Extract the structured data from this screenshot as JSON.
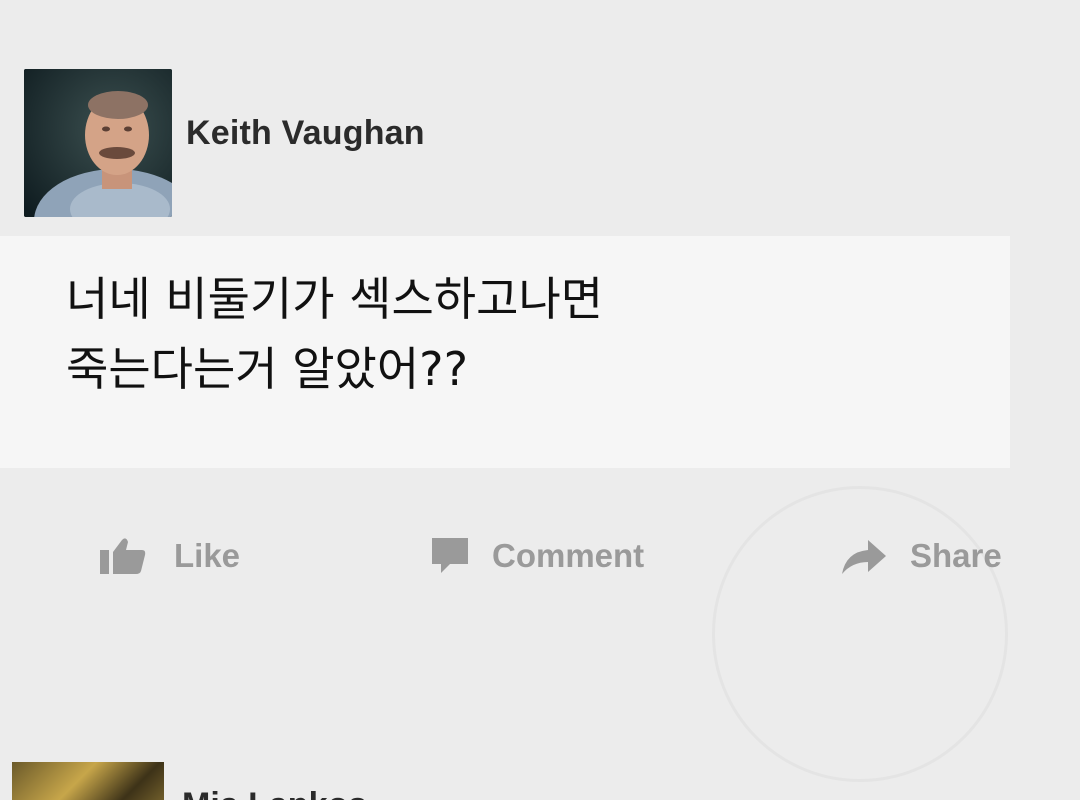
{
  "post": {
    "author": "Keith Vaughan",
    "text": "너네 비둘기가 섹스하고나면\n죽는다는거 알았어??"
  },
  "actions": {
    "like": "Like",
    "comment": "Comment",
    "share": "Share"
  },
  "icons": {
    "like": "thumbs-up-icon",
    "comment": "speech-bubble-icon",
    "share": "share-arrow-icon"
  },
  "next_post": {
    "author": "Mia Lapkos"
  },
  "colors": {
    "background": "#ececec",
    "action_text": "#9a9a9a",
    "author_text": "#2b2b2b"
  }
}
